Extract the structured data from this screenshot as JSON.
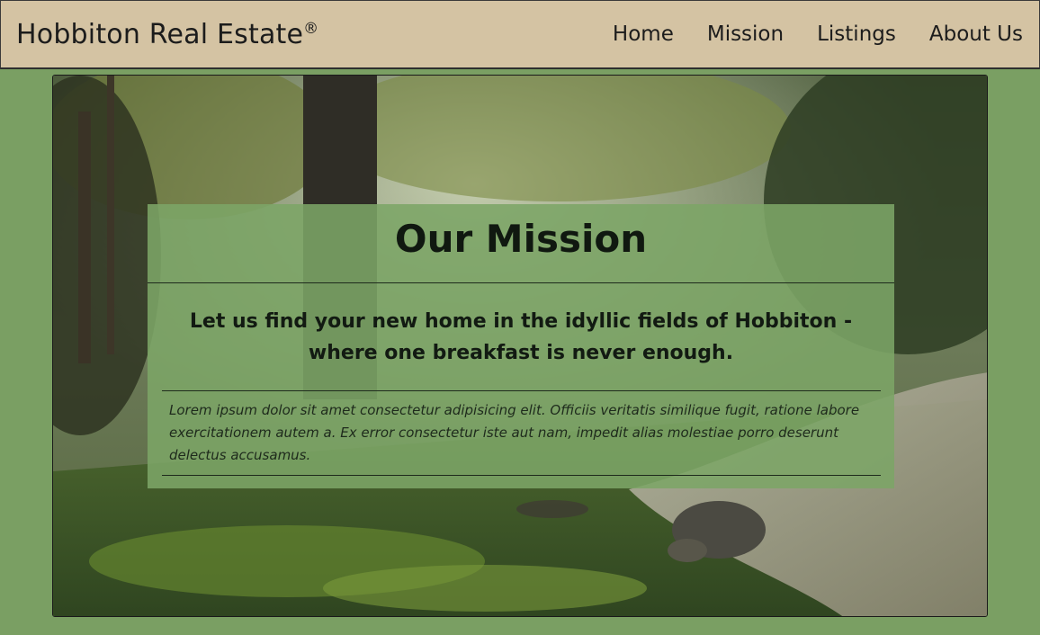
{
  "header": {
    "brand": "Hobbiton Real Estate",
    "brand_mark": "®",
    "nav": [
      {
        "label": "Home"
      },
      {
        "label": "Mission"
      },
      {
        "label": "Listings"
      },
      {
        "label": "About Us"
      }
    ]
  },
  "hero": {
    "image_semantic": "forest-river-photo",
    "title": "Our Mission",
    "tagline": "Let us find your new home in the idyllic fields of Hobbiton - where one breakfast is never enough.",
    "body": "Lorem ipsum dolor sit amet consectetur adipisicing elit. Officiis veritatis similique fugit, ratione labore exercitationem autem a. Ex error consectetur iste aut nam, impedit alias molestiae porro deserunt delectus accusamus."
  },
  "colors": {
    "page_background": "#7a9f63",
    "navbar_background": "#d4c3a3",
    "card_background": "#7ca567"
  }
}
